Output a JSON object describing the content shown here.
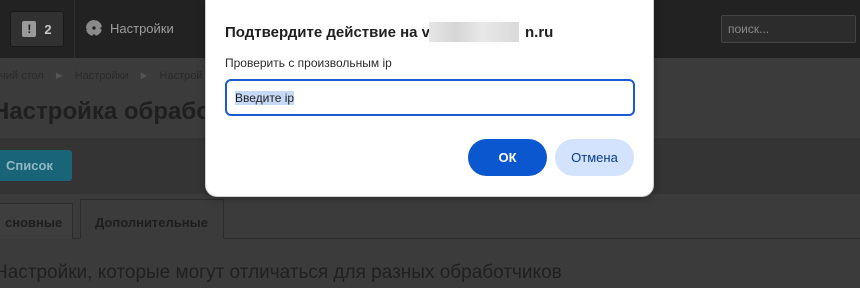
{
  "header": {
    "notifications_count": "2",
    "settings_label": "Настройки",
    "search_placeholder": "поиск..."
  },
  "breadcrumb": {
    "items": [
      "чий стол",
      "Настройки",
      "Настрой"
    ]
  },
  "page": {
    "title": "Настройка обработчи",
    "list_button": "Список",
    "tabs": [
      "сновные",
      "Дополнительные"
    ],
    "section_heading": "Настройки, которые могут отличаться для разных обработчиков"
  },
  "dialog": {
    "title_prefix": "Подтвердите действие на v",
    "title_suffix": "n.ru",
    "message": "Проверить с произвольным ip",
    "input_value": "Введите ip",
    "ok_label": "ОК",
    "cancel_label": "Отмена"
  },
  "colors": {
    "accent": "#0b57d0",
    "cancel_bg": "#d3e3fd",
    "overlay": "#3b3b3b"
  }
}
